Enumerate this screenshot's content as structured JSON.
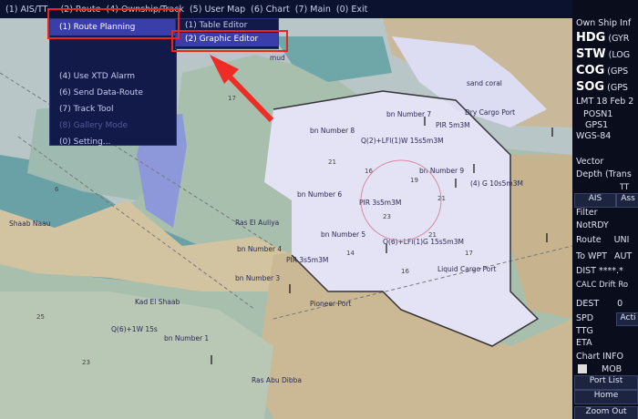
{
  "menubar": {
    "items": [
      "(1) AIS/TT",
      "(2) Route",
      "(4) Ownship/Track",
      "(5) User Map",
      "(6) Chart",
      "(7) Main",
      "(0) Exit"
    ]
  },
  "route_menu": {
    "items": [
      "(1) Route Planning",
      "",
      "",
      "(4) Use XTD Alarm",
      "(6) Send Data-Route",
      "(7) Track Tool",
      "(8) Gallery Mode",
      "(0) Setting..."
    ]
  },
  "route_planning_submenu": {
    "items": [
      "(1) Table Editor",
      "(2) Graphic Editor"
    ]
  },
  "sidebar": {
    "title": "Own Ship Inf",
    "hdg_label": "HDG",
    "hdg_value": "(GYR",
    "stw_label": "STW",
    "stw_value": "(LOG",
    "cog_label": "COG",
    "cog_value": "(GPS",
    "sog_label": "SOG",
    "sog_value": "(GPS",
    "lmt": "LMT 18 Feb 2",
    "posn": "POSN1",
    "gps": "GPS1",
    "datum": "WGS-84",
    "vector": "Vector",
    "depth": "Depth (Trans",
    "tt_label": "TT",
    "ais_label": "AIS",
    "ass_label": "Ass",
    "filter": "Filter",
    "notrdy": "NotRDY",
    "route_label": "Route",
    "route_value": "UNI",
    "towpt_label": "To WPT",
    "towpt_value": "AUT",
    "dist": "DIST ****.*",
    "calc": "CALC",
    "drift": "Drift",
    "ro": "Ro",
    "dest_label": "DEST",
    "dest_value": "0",
    "spd": "SPD",
    "acti": "Acti",
    "ttg": "TTG",
    "eta": "ETA",
    "chart_info": "Chart INFO",
    "mob": "MOB",
    "port_list": "Port List",
    "home": "Home",
    "zoom_out": "Zoom Out"
  },
  "map_labels": {
    "sand_coral": "sand coral",
    "dry_cargo_port": "Dry Cargo Port",
    "pir_5m3m": "PIR 5m3M",
    "q2": "Q(2)+LFl(1)W 15s5m3M",
    "bn9": "bn Number 9",
    "bn7": "bn Number 7",
    "bn8": "bn Number 8",
    "bn6": "bn Number 6",
    "pir2": "PIR 3s5m3M",
    "g10": "(4) G 10s5m3M",
    "ras_auliya": "Ras El Auliya",
    "bn5": "bn Number 5",
    "q6": "Q(6)+LFl(1)G 15s5m3M",
    "bn4": "bn Number 4",
    "pir3": "PIR 3s5m3M",
    "liquid_cargo": "Liquid Cargo Port",
    "bn3": "bn Number 3",
    "pioneer": "Pioneer Port",
    "kad": "Kad El Shaab",
    "q6w": "Q(6)+1W 15s",
    "bn1": "bn Number 1",
    "ras_abu": "Ras Abu Dibba",
    "mud": "mud",
    "shaab": "Shaab Naau"
  }
}
